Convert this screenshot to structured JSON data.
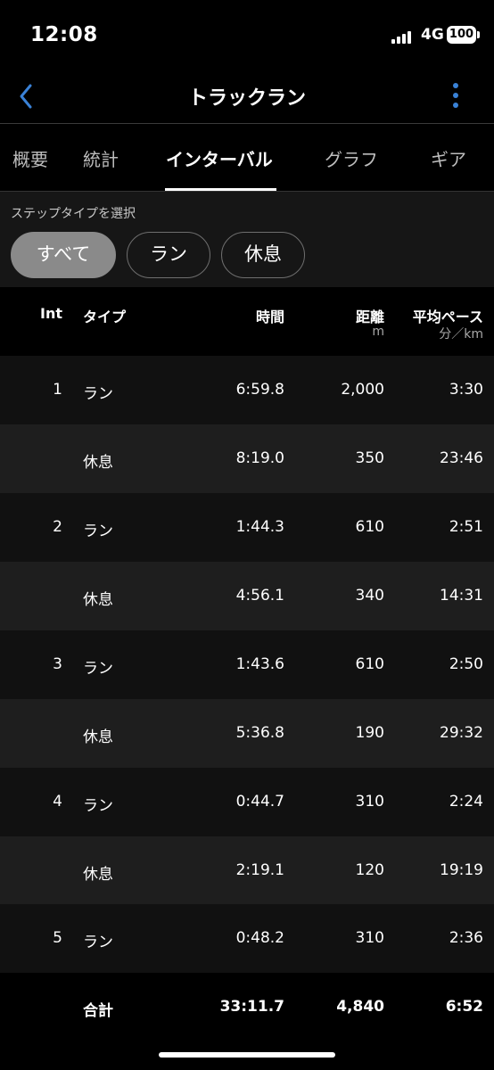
{
  "status": {
    "time": "12:08",
    "network": "4G",
    "battery": "100"
  },
  "nav": {
    "title": "トラックラン",
    "back_icon": "chevron-left-icon",
    "more_icon": "vertical-ellipsis-icon",
    "accent": "#3a82d7"
  },
  "tabs": [
    {
      "label": "概要"
    },
    {
      "label": "統計"
    },
    {
      "label": "インターバル",
      "active": true
    },
    {
      "label": "グラフ"
    },
    {
      "label": "ギア"
    }
  ],
  "filter": {
    "label": "ステップタイプを選択",
    "chips": [
      {
        "label": "すべて",
        "selected": true
      },
      {
        "label": "ラン"
      },
      {
        "label": "休息"
      }
    ]
  },
  "table": {
    "headers": {
      "int": "Int",
      "type": "タイプ",
      "time": "時間",
      "distance": "距離",
      "distance_unit": "m",
      "pace": "平均ペース",
      "pace_unit": "分／km"
    },
    "rows": [
      {
        "int": "1",
        "type": "ラン",
        "time": "6:59.8",
        "distance": "2,000",
        "pace": "3:30"
      },
      {
        "int": "",
        "type": "休息",
        "time": "8:19.0",
        "distance": "350",
        "pace": "23:46"
      },
      {
        "int": "2",
        "type": "ラン",
        "time": "1:44.3",
        "distance": "610",
        "pace": "2:51"
      },
      {
        "int": "",
        "type": "休息",
        "time": "4:56.1",
        "distance": "340",
        "pace": "14:31"
      },
      {
        "int": "3",
        "type": "ラン",
        "time": "1:43.6",
        "distance": "610",
        "pace": "2:50"
      },
      {
        "int": "",
        "type": "休息",
        "time": "5:36.8",
        "distance": "190",
        "pace": "29:32"
      },
      {
        "int": "4",
        "type": "ラン",
        "time": "0:44.7",
        "distance": "310",
        "pace": "2:24"
      },
      {
        "int": "",
        "type": "休息",
        "time": "2:19.1",
        "distance": "120",
        "pace": "19:19"
      },
      {
        "int": "5",
        "type": "ラン",
        "time": "0:48.2",
        "distance": "310",
        "pace": "2:36"
      }
    ],
    "total": {
      "label": "合計",
      "time": "33:11.7",
      "distance": "4,840",
      "pace": "6:52"
    }
  }
}
